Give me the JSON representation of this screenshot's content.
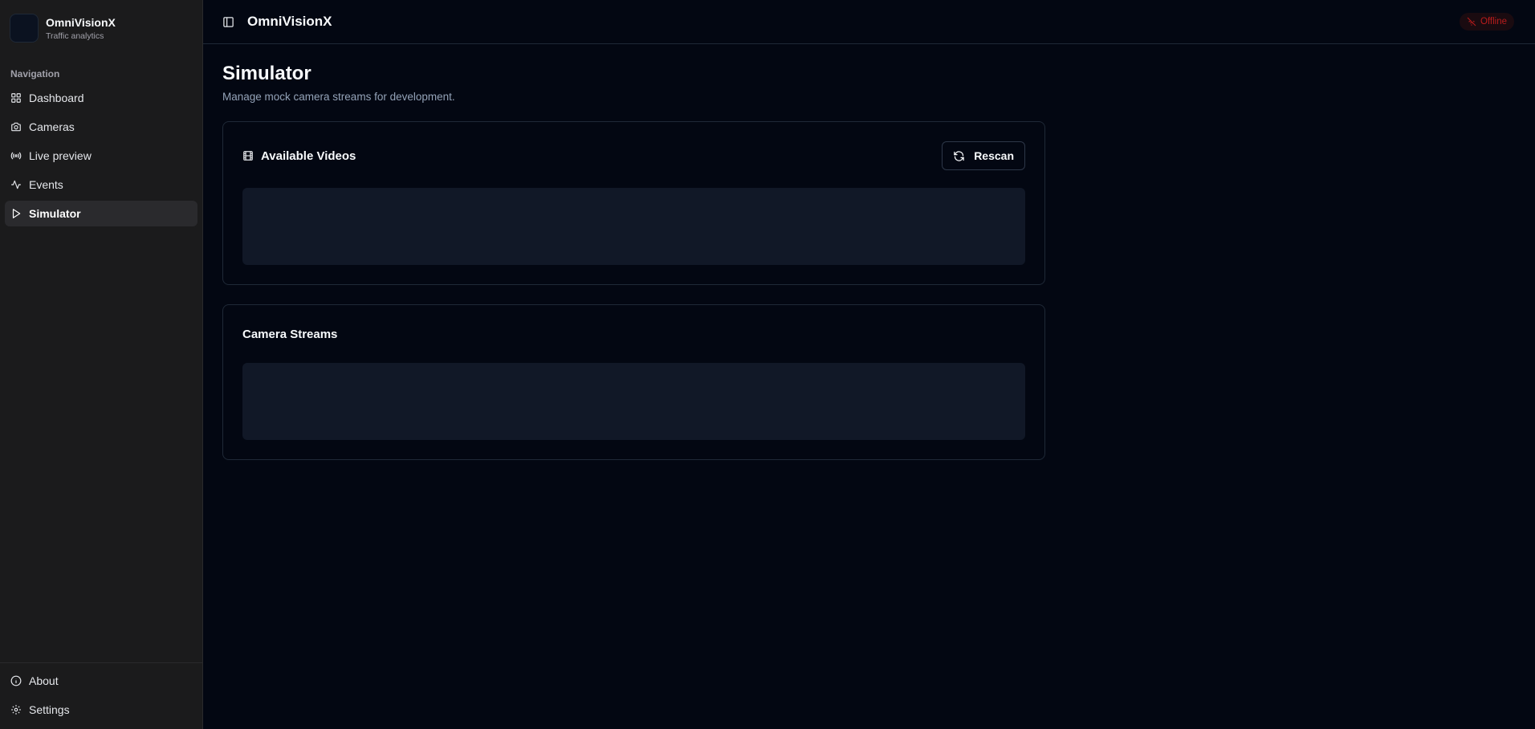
{
  "brand": {
    "name": "OmniVisionX",
    "subtitle": "Traffic analytics"
  },
  "sidebar": {
    "heading": "Navigation",
    "items": [
      {
        "label": "Dashboard",
        "icon": "grid-icon"
      },
      {
        "label": "Cameras",
        "icon": "camera-icon"
      },
      {
        "label": "Live preview",
        "icon": "broadcast-icon"
      },
      {
        "label": "Events",
        "icon": "activity-icon"
      },
      {
        "label": "Simulator",
        "icon": "play-icon",
        "active": true
      }
    ],
    "bottom": [
      {
        "label": "About",
        "icon": "info-icon"
      },
      {
        "label": "Settings",
        "icon": "gear-icon"
      }
    ]
  },
  "topbar": {
    "title": "OmniVisionX",
    "status": "Offline",
    "status_color": "#b91c1c"
  },
  "page": {
    "title": "Simulator",
    "description": "Manage mock camera streams for development."
  },
  "cards": {
    "videos": {
      "title": "Available Videos",
      "button": "Rescan"
    },
    "streams": {
      "title": "Camera Streams"
    }
  }
}
